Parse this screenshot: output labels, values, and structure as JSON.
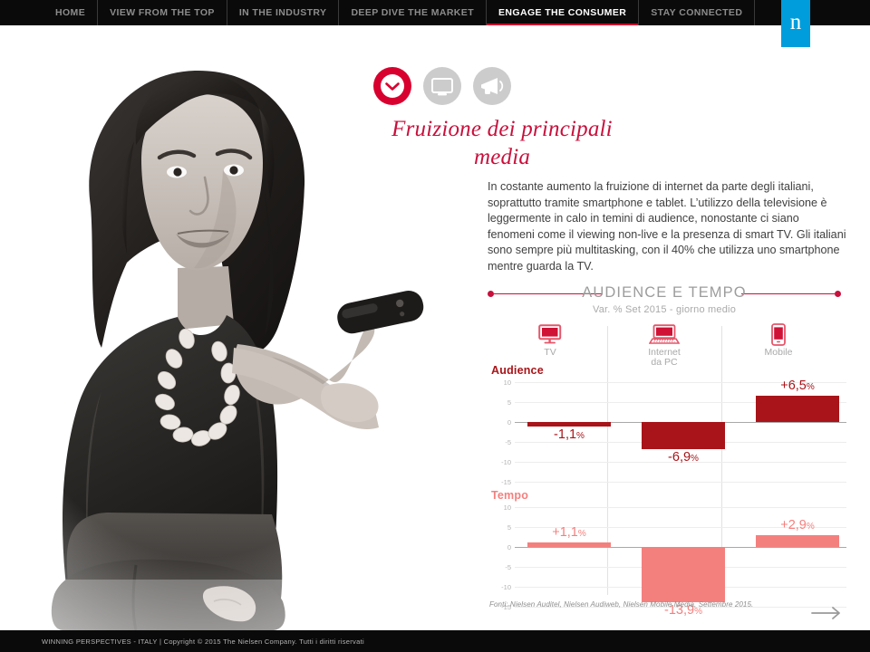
{
  "nav": {
    "items": [
      {
        "label": "HOME",
        "active": false
      },
      {
        "label": "VIEW FROM THE TOP",
        "active": false
      },
      {
        "label": "IN THE INDUSTRY",
        "active": false
      },
      {
        "label": "DEEP DIVE THE MARKET",
        "active": false
      },
      {
        "label": "ENGAGE THE CONSUMER",
        "active": true
      },
      {
        "label": "STAY CONNECTED",
        "active": false
      }
    ],
    "logo_letter": "n",
    "logo_color": "#009ddc",
    "active_underline_color": "#d0102a"
  },
  "icon_row": [
    {
      "name": "clock-icon",
      "state": "active",
      "color": "#d8002e"
    },
    {
      "name": "tv-icon",
      "state": "inactive",
      "color": "#cccccc"
    },
    {
      "name": "megaphone-icon",
      "state": "inactive",
      "color": "#cccccc"
    }
  ],
  "title": "Fruizione\ndei principali media",
  "title_color": "#c8103c",
  "body": "In costante aumento la fruizione di internet da parte degli italiani, soprattutto tramite smartphone e tablet. L’utilizzo della televisione è leggermente in calo in temini di audience, nonostante ci siano fenomeni come il viewing non-live e la presenza di smart TV. Gli italiani sono sempre più multitasking, con il 40% che utilizza uno smartphone mentre guarda la TV.",
  "chart_header": {
    "title": "AUDIENCE E TEMPO",
    "subtitle": "Var. % Set 2015 - giorno medio",
    "rule_color": "#c8103c"
  },
  "source": "Fonti: Nielsen Auditel, Nielsen Audiweb, Nielsen Mobile Media, Settembre 2015.",
  "next_arrow": "arrow-right-icon",
  "footer": "WINNING PERSPECTIVES - ITALY  |   Copyright © 2015 The Nielsen Company. Tutti i diritti riservati",
  "chart_data": [
    {
      "type": "bar",
      "title": "Audience",
      "title_color": "#a81419",
      "bar_color": "#a81419",
      "categories": [
        "TV",
        "Internet\nda PC",
        "Mobile"
      ],
      "category_icons": [
        "tv-device-icon",
        "laptop-device-icon",
        "mobile-device-icon"
      ],
      "values": [
        -1.1,
        -6.9,
        6.5
      ],
      "labels": [
        "-1,1%",
        "-6,9%",
        "+6,5%"
      ],
      "ylim": [
        -15,
        10
      ],
      "yticks": [
        10,
        5,
        0,
        -5,
        -10,
        -15
      ],
      "ytick_labels": [
        "10",
        "5",
        "0",
        "-5",
        "-10",
        "-15"
      ],
      "xlabel": "",
      "ylabel": "",
      "grid": true,
      "legend": "none",
      "unit": "%"
    },
    {
      "type": "bar",
      "title": "Tempo",
      "title_color": "#f4807e",
      "bar_color": "#f4807e",
      "categories": [
        "TV",
        "Internet\nda PC",
        "Mobile"
      ],
      "category_icons": [
        "tv-device-icon",
        "laptop-device-icon",
        "mobile-device-icon"
      ],
      "values": [
        1.1,
        -13.9,
        2.9
      ],
      "labels": [
        "+1,1%",
        "-13,9%",
        "+2,9%"
      ],
      "ylim": [
        -15,
        10
      ],
      "yticks": [
        10,
        5,
        0,
        -5,
        -10,
        -15
      ],
      "ytick_labels": [
        "10",
        "5",
        "0",
        "-5",
        "-10",
        "-15"
      ],
      "xlabel": "",
      "ylabel": "",
      "grid": true,
      "legend": "none",
      "unit": "%"
    }
  ]
}
